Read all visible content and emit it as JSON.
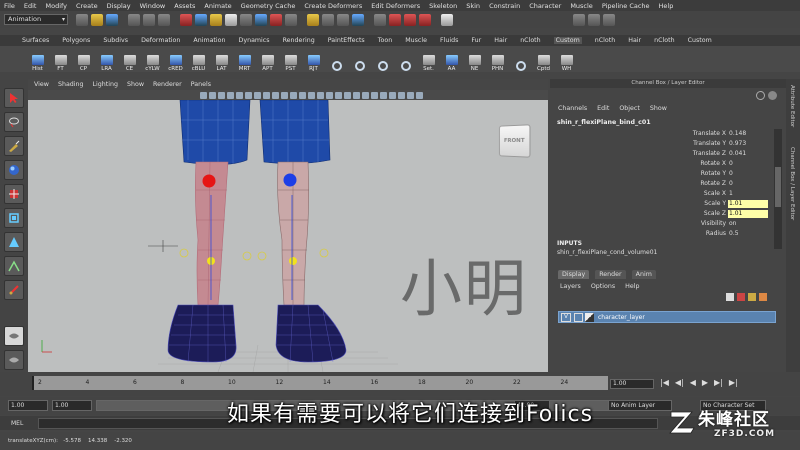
{
  "menubar": [
    "File",
    "Edit",
    "Modify",
    "Create",
    "Display",
    "Window",
    "Assets",
    "Animate",
    "Geometry Cache",
    "Create Deformers",
    "Edit Deformers",
    "Skeleton",
    "Skin",
    "Constrain",
    "Character",
    "Muscle",
    "Pipeline Cache",
    "Help"
  ],
  "statusline": {
    "mode": "Animation"
  },
  "shelf_tabs": [
    "Surfaces",
    "Polygons",
    "Subdivs",
    "Deformation",
    "Animation",
    "Dynamics",
    "Rendering",
    "PaintEffects",
    "Toon",
    "Muscle",
    "Fluids",
    "Fur",
    "Hair",
    "nCloth",
    "Custom",
    "nCloth",
    "Hair",
    "nCloth",
    "Custom"
  ],
  "shelf_tab_active": "Custom",
  "shelf_buttons": [
    "Hist",
    "FT",
    "CP",
    "LRA",
    "CE",
    "cYLW",
    "cRED",
    "cBLU",
    "LAT",
    "MRT",
    "APT",
    "PST",
    "RJT",
    "",
    "",
    "",
    "",
    "Set.",
    "AA",
    "NE",
    "PHN",
    "",
    "Cptd",
    "WH"
  ],
  "viewport": {
    "menu": [
      "View",
      "Shading",
      "Lighting",
      "Show",
      "Renderer",
      "Panels"
    ],
    "viewcube_label": "FRONT",
    "watermark": "小明"
  },
  "channel_box": {
    "panel_title": "Channel Box / Layer Editor",
    "menu": [
      "Channels",
      "Edit",
      "Object",
      "Show"
    ],
    "object_name": "shin_r_flexiPlane_bind_c01",
    "attributes": [
      {
        "label": "Translate X",
        "value": "0.148",
        "highlight": false
      },
      {
        "label": "Translate Y",
        "value": "0.973",
        "highlight": false
      },
      {
        "label": "Translate Z",
        "value": "0.041",
        "highlight": false
      },
      {
        "label": "Rotate X",
        "value": "0",
        "highlight": false
      },
      {
        "label": "Rotate Y",
        "value": "0",
        "highlight": false
      },
      {
        "label": "Rotate Z",
        "value": "0",
        "highlight": false
      },
      {
        "label": "Scale X",
        "value": "1",
        "highlight": false
      },
      {
        "label": "Scale Y",
        "value": "1.01",
        "highlight": true
      },
      {
        "label": "Scale Z",
        "value": "1.01",
        "highlight": true
      },
      {
        "label": "Visibility",
        "value": "on",
        "highlight": false
      },
      {
        "label": "Radius",
        "value": "0.5",
        "highlight": false
      }
    ],
    "inputs_label": "INPUTS",
    "input_node": "shin_r_flexiPlane_cond_volume01",
    "layer_tabs": [
      "Display",
      "Render",
      "Anim"
    ],
    "layer_menu": [
      "Layers",
      "Options",
      "Help"
    ],
    "layer_visible": "V",
    "layer_name": "character_layer"
  },
  "side_strip": [
    "Attribute Editor",
    "Channel Box / Layer Editor"
  ],
  "timeline": {
    "ticks": [
      "2",
      "4",
      "6",
      "8",
      "10",
      "12",
      "14",
      "16",
      "18",
      "20",
      "22",
      "24"
    ],
    "current_frame": "1.00",
    "buttons": [
      "|◀",
      "◀|",
      "◀",
      "▶",
      "▶|",
      "▶|"
    ]
  },
  "range": {
    "start": "1.00",
    "inner_start": "1.00",
    "inner_end": "48.00",
    "end": "",
    "anim_layer": "No Anim Layer",
    "char_set": "No Character Set"
  },
  "mel": {
    "label": "MEL"
  },
  "helpline": "translateXYZ(cm):   -5.578    14.338    -2.320",
  "subtitle": "如果有需要可以将它们连接到Folics",
  "logo": {
    "main": "朱峰社区",
    "sub": "ZF3D.COM"
  }
}
